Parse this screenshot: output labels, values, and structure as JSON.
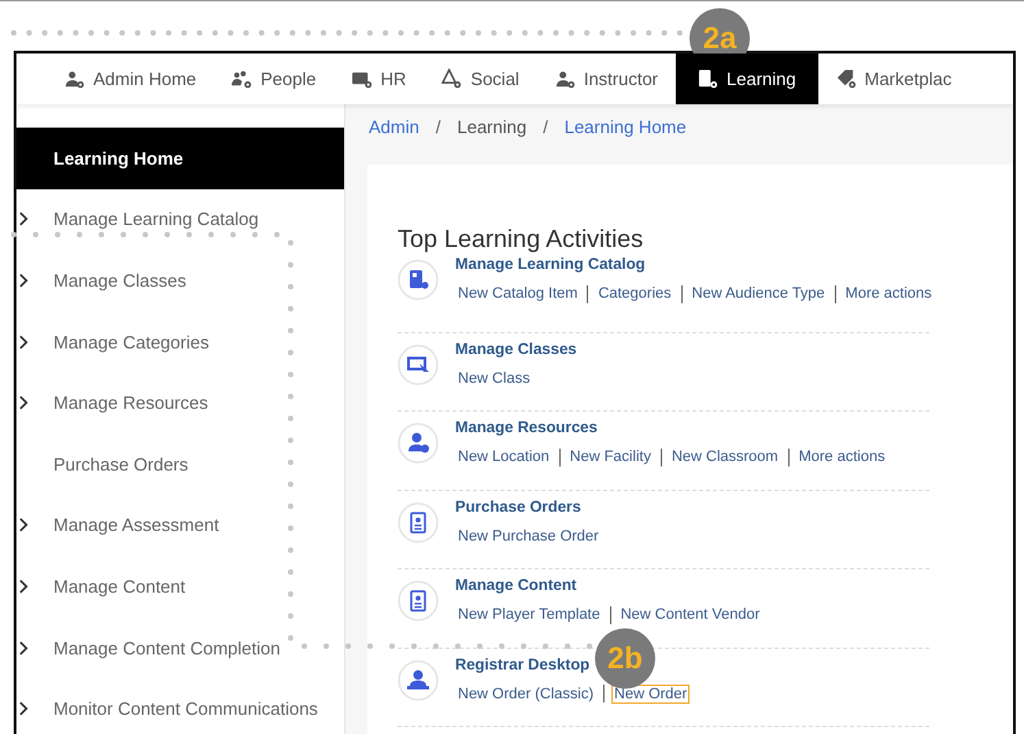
{
  "callouts": [
    {
      "label": "2a"
    },
    {
      "label": "2b"
    }
  ],
  "nav_tabs": [
    {
      "label": "Admin Home",
      "selected": false
    },
    {
      "label": "People",
      "selected": false
    },
    {
      "label": "HR",
      "selected": false
    },
    {
      "label": "Social",
      "selected": false
    },
    {
      "label": "Instructor",
      "selected": false
    },
    {
      "label": "Learning",
      "selected": true
    },
    {
      "label": "Marketplac",
      "selected": false
    }
  ],
  "breadcrumb": [
    {
      "label": "Admin"
    },
    {
      "separator": "/",
      "label": "Learning"
    },
    {
      "separator": "/",
      "label": "Learning Home"
    }
  ],
  "sidebar": {
    "items": [
      {
        "label": "Learning Home",
        "selected": true,
        "has_children": false
      },
      {
        "label": "Manage Learning Catalog",
        "selected": false,
        "has_children": true
      },
      {
        "label": "Manage Classes",
        "selected": false,
        "has_children": true
      },
      {
        "label": "Manage Categories",
        "selected": false,
        "has_children": true
      },
      {
        "label": "Manage Resources",
        "selected": false,
        "has_children": true
      },
      {
        "label": "Purchase Orders",
        "selected": false,
        "has_children": false
      },
      {
        "label": "Manage Assessment",
        "selected": false,
        "has_children": true
      },
      {
        "label": "Manage Content",
        "selected": false,
        "has_children": true
      },
      {
        "label": "Manage Content Completion",
        "selected": false,
        "has_children": true
      },
      {
        "label": "Monitor Content Communications",
        "selected": false,
        "has_children": true
      }
    ]
  },
  "activities": {
    "title": "Top Learning Activities",
    "items": [
      {
        "title": "Manage Learning Catalog",
        "links": [
          {
            "label": "New Catalog Item",
            "highlighted": false
          },
          {
            "label": "Categories",
            "highlighted": false
          },
          {
            "label": "New Audience Type",
            "highlighted": false
          },
          {
            "label": "More actions",
            "highlighted": false
          }
        ]
      },
      {
        "title": "Manage Classes",
        "links": [
          {
            "label": "New Class",
            "highlighted": false
          }
        ]
      },
      {
        "title": "Manage Resources",
        "links": [
          {
            "label": "New Location",
            "highlighted": false
          },
          {
            "label": "New Facility",
            "highlighted": false
          },
          {
            "label": "New Classroom",
            "highlighted": false
          },
          {
            "label": "More actions",
            "highlighted": false
          }
        ]
      },
      {
        "title": "Purchase Orders",
        "links": [
          {
            "label": "New Purchase Order",
            "highlighted": false
          }
        ]
      },
      {
        "title": "Manage Content",
        "links": [
          {
            "label": "New Player Template",
            "highlighted": false
          },
          {
            "label": "New Content Vendor",
            "highlighted": false
          }
        ]
      },
      {
        "title": "Registrar Desktop",
        "links": [
          {
            "label": "New Order (Classic)",
            "highlighted": false
          },
          {
            "label": "New Order",
            "highlighted": true
          }
        ]
      }
    ]
  }
}
